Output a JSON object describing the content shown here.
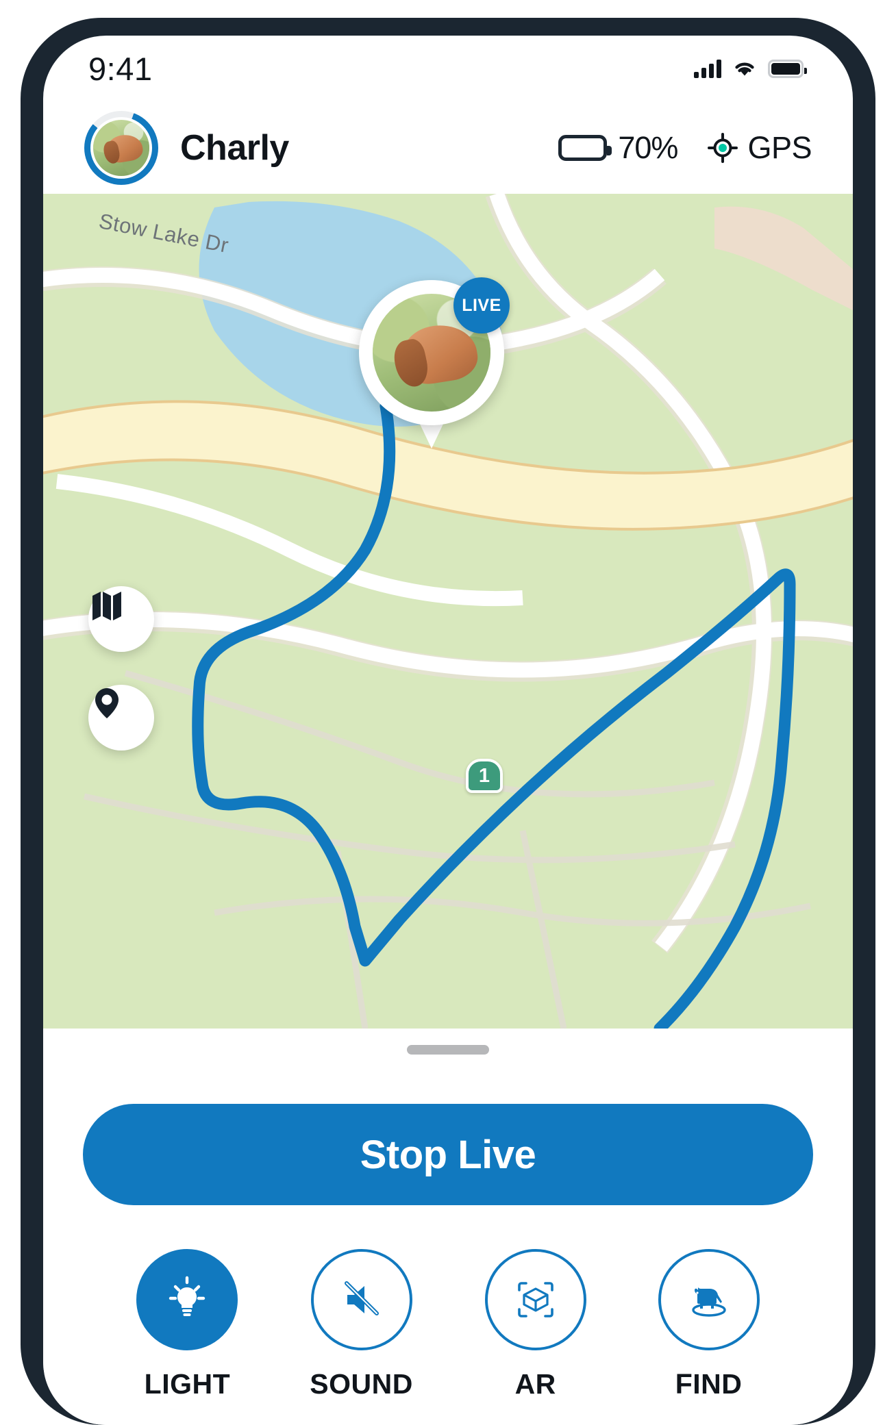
{
  "status_bar": {
    "time": "9:41",
    "icons": [
      "signal-bars-icon",
      "wifi-icon",
      "battery-full-icon"
    ]
  },
  "header": {
    "pet_name": "Charly",
    "avatar": {
      "icon": "dog-avatar",
      "ring_percent": 80
    },
    "battery": {
      "percent_label": "70%",
      "fill_percent": 70,
      "color": "#00c7a4"
    },
    "gps": {
      "label": "GPS",
      "icon": "gps-target-icon",
      "color": "#00c7a4"
    }
  },
  "map": {
    "street_label": "Stow Lake Dr",
    "route_shield": "1",
    "poi_restroom_icon": "restroom-icon",
    "track_color": "#1179bf",
    "water_color": "#a8d5ea",
    "park_color": "#d8e8bd",
    "road_color": "#ffffff",
    "highway_color": "#fbf3cd",
    "pin": {
      "badge": "LIVE",
      "badge_color": "#1179bf",
      "photo_icon": "dog-photo"
    },
    "controls": [
      {
        "name": "map-layers",
        "icon": "map-layers-icon"
      },
      {
        "name": "locate",
        "icon": "location-pin-icon"
      }
    ]
  },
  "bottom_sheet": {
    "handle": "drag-handle",
    "primary_button": {
      "label": "Stop Live",
      "color": "#1179bf"
    },
    "actions": [
      {
        "label": "LIGHT",
        "icon": "lightbulb-icon",
        "active": true
      },
      {
        "label": "SOUND",
        "icon": "speaker-muted-icon",
        "active": false
      },
      {
        "label": "AR",
        "icon": "ar-cube-icon",
        "active": false
      },
      {
        "label": "FIND",
        "icon": "dog-radar-icon",
        "active": false
      }
    ]
  }
}
